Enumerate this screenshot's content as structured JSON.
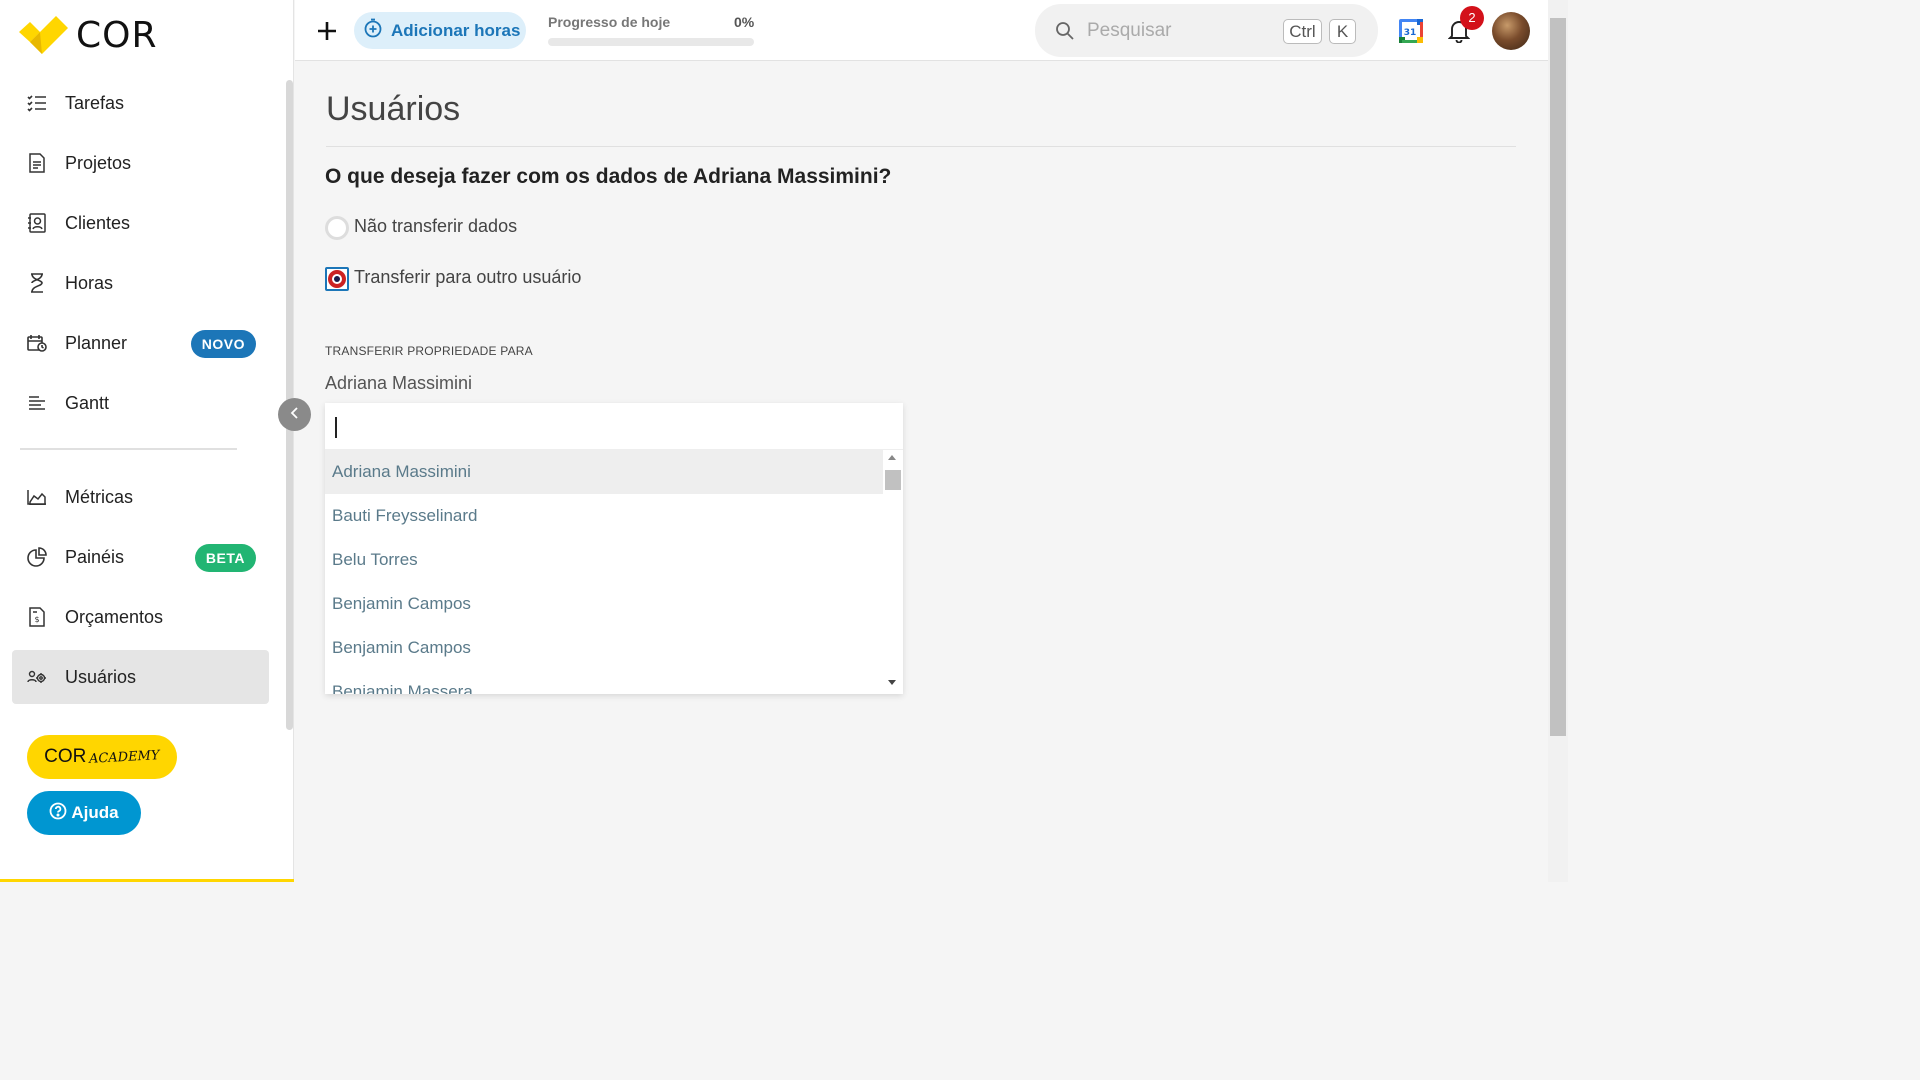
{
  "brand": {
    "logo_text": "COR",
    "logo_color": "#ffd600"
  },
  "sidebar": {
    "items": [
      {
        "label": "Tarefas",
        "icon": "tasks-list-icon"
      },
      {
        "label": "Projetos",
        "icon": "project-document-icon"
      },
      {
        "label": "Clientes",
        "icon": "client-contact-icon"
      },
      {
        "label": "Horas",
        "icon": "hourglass-icon"
      },
      {
        "label": "Planner",
        "icon": "calendar-clock-icon",
        "badge": "NOVO",
        "badge_color": "#1c76b8"
      },
      {
        "label": "Gantt",
        "icon": "gantt-lines-icon"
      },
      {
        "label": "Métricas",
        "icon": "area-chart-icon"
      },
      {
        "label": "Painéis",
        "icon": "pie-chart-icon",
        "badge": "BETA",
        "badge_color": "#22b573"
      },
      {
        "label": "Orçamentos",
        "icon": "budget-document-icon"
      },
      {
        "label": "Usuários",
        "icon": "users-gear-icon",
        "active": true
      }
    ],
    "academy_label": "COR",
    "academy_sub": "ACADEMY",
    "help_label": "Ajuda"
  },
  "topbar": {
    "add_hours_label": "Adicionar horas",
    "progress_label": "Progresso de hoje",
    "progress_percent_text": "0%",
    "progress_value": 0,
    "search_placeholder": "Pesquisar",
    "shortcut_ctrl": "Ctrl",
    "shortcut_k": "K",
    "calendar_day": "31",
    "notification_count": "2"
  },
  "main": {
    "title": "Usuários",
    "question": "O que deseja fazer com os dados de Adriana Massimini?",
    "option_no_transfer": "Não transferir dados",
    "option_transfer": "Transferir para outro usuário",
    "selected_option": "transfer",
    "transfer_heading": "TRANSFERIR PROPRIEDADE PARA",
    "selected_user": "Adriana Massimini",
    "dropdown_search_value": "",
    "dropdown_options": [
      "Adriana Massimini",
      "Bauti Freysselinard",
      "Belu Torres",
      "Benjamin Campos",
      "Benjamin Campos",
      "Benjamin Massera"
    ]
  }
}
